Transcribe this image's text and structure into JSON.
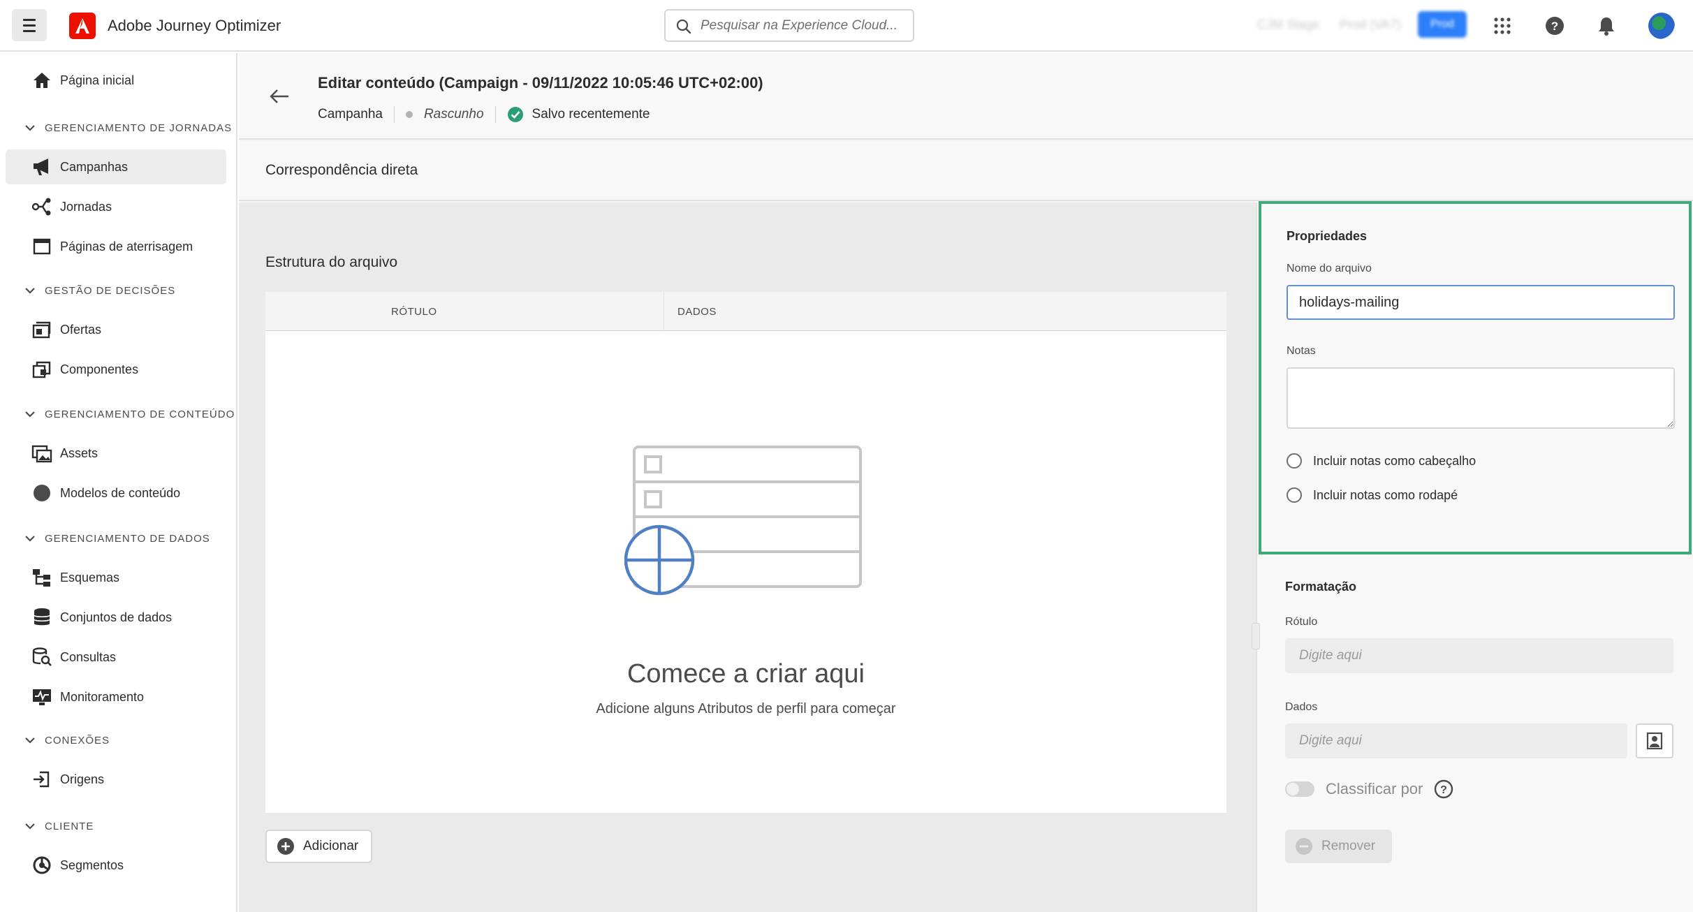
{
  "topbar": {
    "app_title": "Adobe Journey Optimizer",
    "search_placeholder": "Pesquisar na Experience Cloud...",
    "org_name": "CJM Stage",
    "sandbox_name": "Prod (VA7)",
    "env_badge": "Prod"
  },
  "sidebar": {
    "home": "Página inicial",
    "sections": [
      {
        "label": "GERENCIAMENTO DE JORNADAS",
        "items": [
          "Campanhas",
          "Jornadas",
          "Páginas de aterrisagem"
        ]
      },
      {
        "label": "GESTÃO DE DECISÕES",
        "items": [
          "Ofertas",
          "Componentes"
        ]
      },
      {
        "label": "GERENCIAMENTO DE CONTEÚDO",
        "items": [
          "Assets",
          "Modelos de conteúdo"
        ]
      },
      {
        "label": "GERENCIAMENTO DE DADOS",
        "items": [
          "Esquemas",
          "Conjuntos de dados",
          "Consultas",
          "Monitoramento"
        ]
      },
      {
        "label": "CONEXÕES",
        "items": [
          "Origens"
        ]
      },
      {
        "label": "CLIENTE",
        "items": [
          "Segmentos"
        ]
      }
    ],
    "active_item": "Campanhas"
  },
  "header": {
    "title": "Editar conteúdo (Campaign - 09/11/2022 10:05:46 UTC+02:00)",
    "type": "Campanha",
    "status": "Rascunho",
    "saved": "Salvo recentemente",
    "status_color": "#2d9d78"
  },
  "subheader": {
    "title": "Correspondência direta"
  },
  "structure": {
    "title": "Estrutura do arquivo",
    "columns": [
      "RÓTULO",
      "DADOS"
    ],
    "empty_title": "Comece a criar aqui",
    "empty_subtitle": "Adicione alguns Atributos de perfil para começar",
    "add_label": "Adicionar"
  },
  "properties": {
    "title": "Propriedades",
    "filename_label": "Nome do arquivo",
    "filename_value": "holidays-mailing",
    "notes_label": "Notas",
    "notes_value": "",
    "radio_header": "Incluir notas como cabeçalho",
    "radio_footer": "Incluir notas como rodapé",
    "highlight_color": "#3fa97a"
  },
  "formatting": {
    "title": "Formatação",
    "label_label": "Rótulo",
    "label_placeholder": "Digite aqui",
    "data_label": "Dados",
    "data_placeholder": "Digite aqui",
    "sort_label": "Classificar por",
    "remove_label": "Remover"
  }
}
